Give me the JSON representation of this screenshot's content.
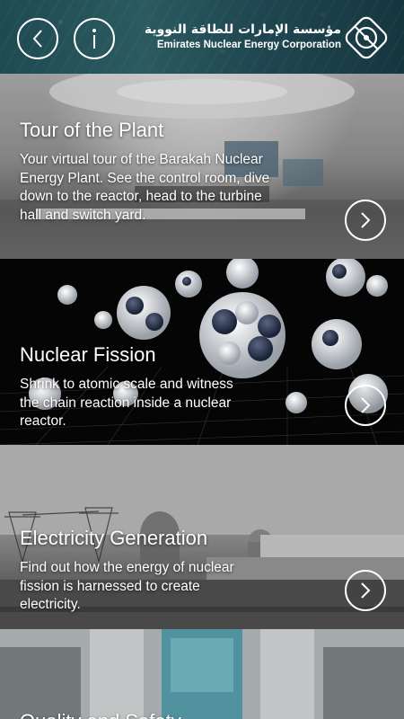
{
  "header": {
    "logo_arabic": "مؤسسة الإمارات للطاقة النووية",
    "logo_english": "Emirates Nuclear Energy Corporation",
    "back_icon": "chevron-left-icon",
    "info_icon": "info-icon"
  },
  "cards": [
    {
      "title": "Tour of the Plant",
      "description": "Your virtual tour of the Barakah Nuclear Energy Plant. See the control room, dive down to the reactor, head to the turbine hall and switch yard."
    },
    {
      "title": "Nuclear Fission",
      "description": "Shrink to atomic scale and witness the chain reaction inside a nuclear reactor."
    },
    {
      "title": "Electricity Generation",
      "description": "Find out how the energy of nuclear fission is harnessed to create electricity."
    },
    {
      "title": "Quality and Safety",
      "description": ""
    }
  ],
  "colors": {
    "header_bg": "#2b5a60",
    "text": "#ffffff"
  }
}
